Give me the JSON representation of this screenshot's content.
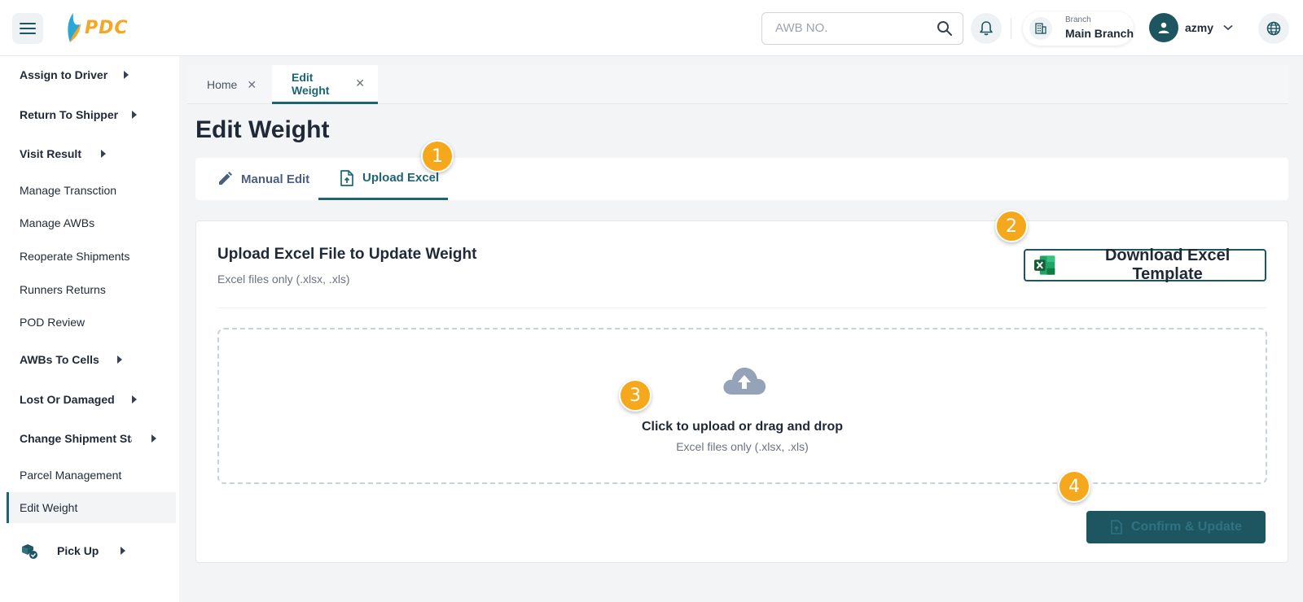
{
  "header": {
    "logo_text": "PDC",
    "search": {
      "placeholder": "AWB NO."
    },
    "branch": {
      "label": "Branch",
      "name": "Main Branch"
    },
    "user": {
      "name": "azmy"
    }
  },
  "sidebar": {
    "items": [
      {
        "label": "Assign to Driver",
        "expandable": true
      },
      {
        "label": "Return To Shipper",
        "expandable": true
      },
      {
        "label": "Visit Result",
        "expandable": true
      },
      {
        "label": "Manage Transction",
        "expandable": false
      },
      {
        "label": "Manage AWBs",
        "expandable": false
      },
      {
        "label": "Reoperate Shipments",
        "expandable": false
      },
      {
        "label": "Runners Returns",
        "expandable": false
      },
      {
        "label": "POD Review",
        "expandable": false
      },
      {
        "label": "AWBs To Cells",
        "expandable": true
      },
      {
        "label": "Lost Or Damaged",
        "expandable": true
      },
      {
        "label": "Change Shipment Sta",
        "expandable": true
      },
      {
        "label": "Parcel Management",
        "expandable": false
      },
      {
        "label": "Edit Weight",
        "expandable": false,
        "active": true
      },
      {
        "label": "Pick Up",
        "expandable": true
      }
    ]
  },
  "tabs": [
    {
      "label": "Home",
      "active": false
    },
    {
      "label": "Edit Weight",
      "active": true
    }
  ],
  "page": {
    "title": "Edit Weight",
    "subtabs": [
      {
        "label": "Manual Edit",
        "active": false
      },
      {
        "label": "Upload Excel",
        "active": true
      }
    ],
    "card": {
      "title": "Upload Excel File to Update Weight",
      "subtitle": "Excel files only (.xlsx, .xls)",
      "download_button": "Download Excel Template",
      "dropzone": {
        "main_text": "Click to upload or drag and drop",
        "sub_text": "Excel files only (.xlsx, .xls)"
      },
      "confirm_button": "Confirm & Update"
    }
  },
  "badges": [
    "1",
    "2",
    "3",
    "4"
  ],
  "colors": {
    "primary": "#1d5561",
    "accent": "#1d6573",
    "badge": "#f5a81c",
    "logo": "#f5a623"
  }
}
